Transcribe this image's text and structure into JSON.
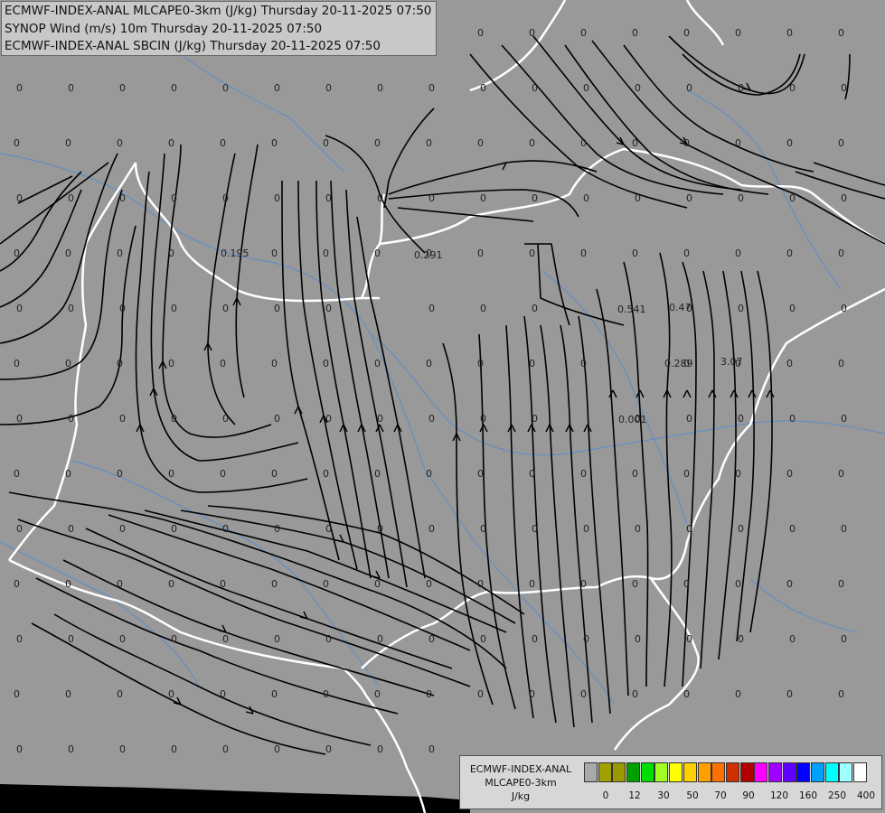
{
  "title": {
    "line1": "ECMWF-INDEX-ANAL MLCAPE0-3km (J/kg) Thursday 20-11-2025 07:50",
    "line2": "SYNOP Wind (m/s) 10m Thursday 20-11-2025 07:50",
    "line3": "ECMWF-INDEX-ANAL SBCIN (J/kg) Thursday 20-11-2025 07:50"
  },
  "legend": {
    "label_line1": "ECMWF-INDEX-ANAL",
    "label_line2": "MLCAPE0-3km",
    "label_line3": "J/kg",
    "colors": [
      "#a9a9a9",
      "#a0a000",
      "#9a9a00",
      "#00a000",
      "#00e000",
      "#a0ff20",
      "#ffff00",
      "#ffd000",
      "#ffa000",
      "#ff7000",
      "#d03000",
      "#b00000",
      "#ff00ff",
      "#a000ff",
      "#6000ff",
      "#0000ff",
      "#00a0ff",
      "#00ffff",
      "#a0ffff",
      "#ffffff"
    ],
    "ticks": [
      "0",
      "12",
      "30",
      "50",
      "70",
      "90",
      "120",
      "160",
      "250",
      "400"
    ]
  },
  "cin_labels": [
    "0.195",
    "0.291",
    "0.541",
    "0.47",
    "0.289",
    "3.07",
    "0.001"
  ],
  "grid_value": "0",
  "colors": {
    "background": "#999999",
    "border": "#ffffff",
    "river": "#5a8ccc",
    "streamline": "#000000",
    "sea": "#000000"
  }
}
